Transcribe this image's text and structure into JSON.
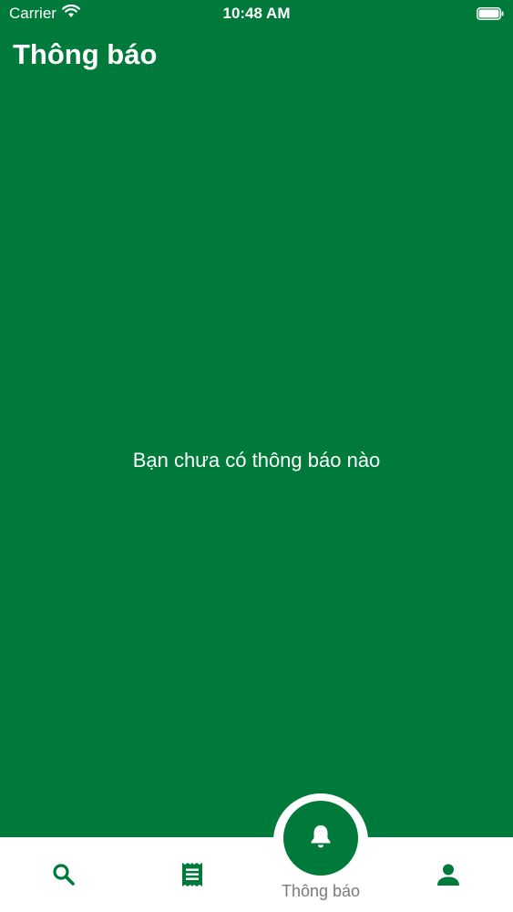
{
  "status_bar": {
    "carrier": "Carrier",
    "time": "10:48 AM"
  },
  "header": {
    "title": "Thông báo"
  },
  "empty_state": {
    "message": "Bạn chưa có thông báo nào"
  },
  "tab_bar": {
    "items": [
      {
        "icon": "search-icon",
        "active": false
      },
      {
        "icon": "receipt-icon",
        "active": false
      },
      {
        "icon": "bell-icon",
        "label": "Thông báo",
        "active": true
      },
      {
        "icon": "person-icon",
        "active": false
      }
    ]
  },
  "colors": {
    "primary": "#007a3a",
    "tab_bar_background": "#ffffff",
    "inactive_label": "#7a7a7a"
  }
}
